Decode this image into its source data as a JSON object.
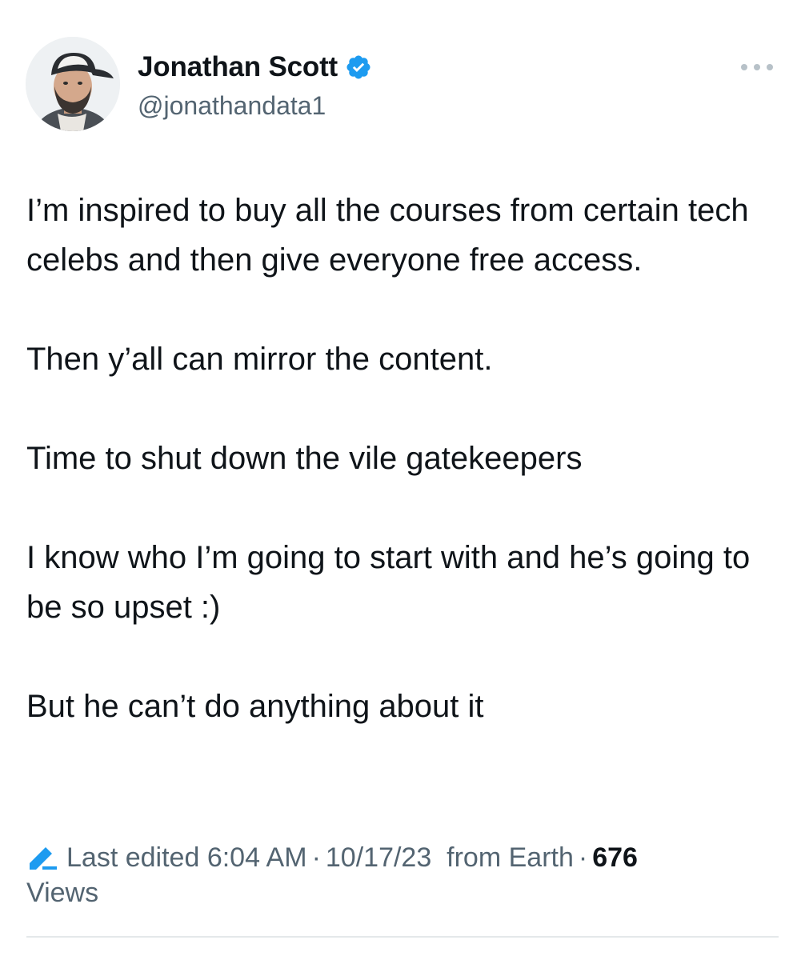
{
  "author": {
    "display_name": "Jonathan Scott",
    "handle": "@jonathandata1",
    "verified": true,
    "avatar_icon": "user-avatar-photo",
    "verified_icon": "verified-badge-icon",
    "verified_color": "#1d9bf0"
  },
  "actions": {
    "more_icon": "more-horizontal-icon"
  },
  "tweet": {
    "paragraphs": [
      "I’m inspired to buy all the courses from certain tech celebs and then give everyone free access.",
      "Then y’all can mirror the content.",
      "Time to shut down the vile gatekeepers",
      "I know who I’m going to start with and he’s going to be so upset :)",
      "But he can’t do anything about it"
    ]
  },
  "meta": {
    "edit_icon": "pencil-edit-icon",
    "edit_prefix": "Last edited",
    "time": "6:04 AM",
    "separator": "·",
    "date": "10/17/23",
    "location": "from Earth",
    "views_count": "676",
    "views_label": "Views"
  },
  "colors": {
    "text_primary": "#0f1419",
    "text_secondary": "#536471",
    "accent": "#1d9bf0"
  }
}
